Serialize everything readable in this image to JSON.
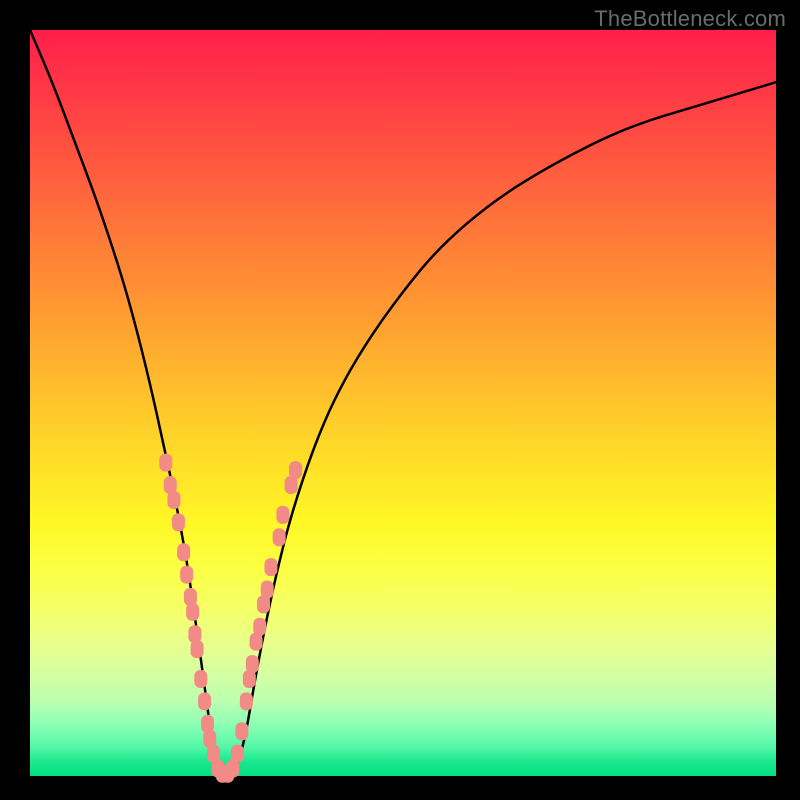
{
  "watermark": "TheBottleneck.com",
  "chart_data": {
    "type": "line",
    "title": "",
    "xlabel": "",
    "ylabel": "",
    "xlim": [
      0,
      100
    ],
    "ylim": [
      0,
      100
    ],
    "grid": false,
    "legend": false,
    "series": [
      {
        "name": "curve",
        "color": "#000000",
        "x": [
          0,
          3,
          6,
          9,
          12,
          14,
          16,
          18,
          19.5,
          21,
          22,
          23,
          23.8,
          24.5,
          25.2,
          26,
          27,
          28,
          29,
          30,
          31.5,
          33,
          35,
          38,
          41,
          45,
          50,
          55,
          62,
          70,
          80,
          90,
          100
        ],
        "y": [
          100,
          93,
          85,
          77,
          68,
          61,
          53,
          44,
          37,
          29,
          22,
          15,
          9,
          4,
          1,
          0,
          0,
          2,
          6,
          12,
          20,
          27,
          35,
          44,
          51,
          58,
          65,
          71,
          77,
          82,
          87,
          90,
          93
        ]
      }
    ],
    "scatter_points": {
      "name": "markers",
      "color": "#f28a86",
      "points": [
        {
          "x": 18.2,
          "y": 42
        },
        {
          "x": 18.8,
          "y": 39
        },
        {
          "x": 19.3,
          "y": 37
        },
        {
          "x": 19.9,
          "y": 34
        },
        {
          "x": 20.6,
          "y": 30
        },
        {
          "x": 21.0,
          "y": 27
        },
        {
          "x": 21.5,
          "y": 24
        },
        {
          "x": 21.8,
          "y": 22
        },
        {
          "x": 22.1,
          "y": 19
        },
        {
          "x": 22.4,
          "y": 17
        },
        {
          "x": 22.9,
          "y": 13
        },
        {
          "x": 23.4,
          "y": 10
        },
        {
          "x": 23.8,
          "y": 7
        },
        {
          "x": 24.1,
          "y": 5
        },
        {
          "x": 24.6,
          "y": 3
        },
        {
          "x": 25.2,
          "y": 1
        },
        {
          "x": 25.8,
          "y": 0.3
        },
        {
          "x": 26.5,
          "y": 0.3
        },
        {
          "x": 27.2,
          "y": 1
        },
        {
          "x": 27.8,
          "y": 3
        },
        {
          "x": 28.4,
          "y": 6
        },
        {
          "x": 29.0,
          "y": 10
        },
        {
          "x": 29.4,
          "y": 13
        },
        {
          "x": 29.8,
          "y": 15
        },
        {
          "x": 30.3,
          "y": 18
        },
        {
          "x": 30.8,
          "y": 20
        },
        {
          "x": 31.3,
          "y": 23
        },
        {
          "x": 31.8,
          "y": 25
        },
        {
          "x": 32.3,
          "y": 28
        },
        {
          "x": 33.4,
          "y": 32
        },
        {
          "x": 33.9,
          "y": 35
        },
        {
          "x": 35.0,
          "y": 39
        },
        {
          "x": 35.6,
          "y": 41
        }
      ]
    }
  }
}
